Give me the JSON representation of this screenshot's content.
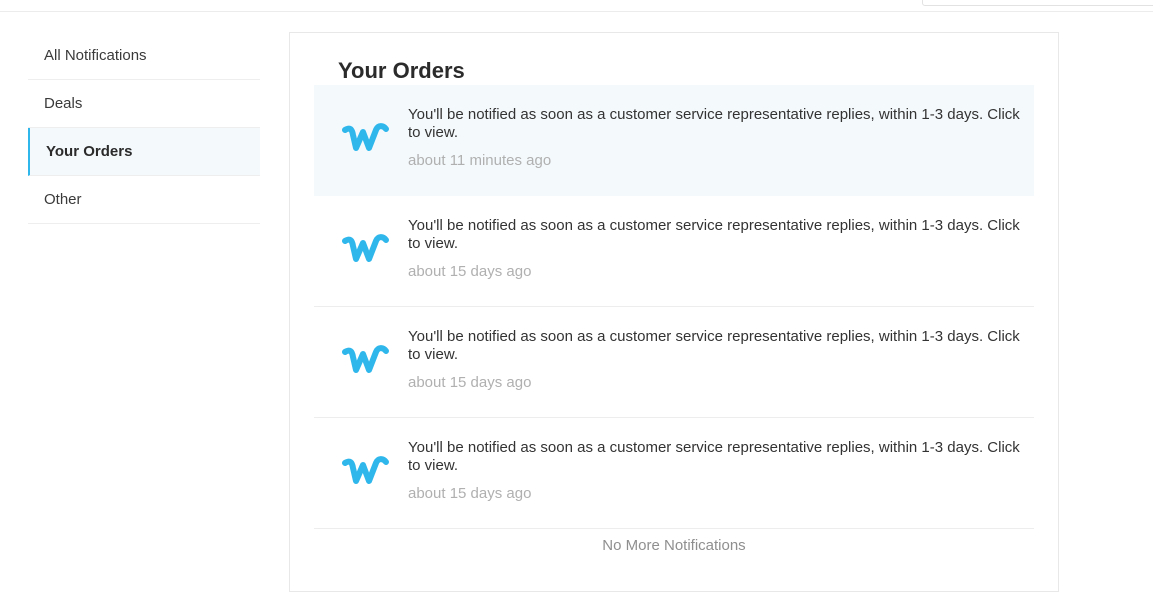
{
  "sidebar": {
    "items": [
      {
        "label": "All Notifications"
      },
      {
        "label": "Deals"
      },
      {
        "label": "Your Orders"
      },
      {
        "label": "Other"
      }
    ],
    "active_index": 2
  },
  "panel": {
    "title": "Your Orders",
    "notifications": [
      {
        "icon": "wish-logo-icon",
        "message": "You'll be notified as soon as a customer service representative replies, within 1-3 days. Click to view.",
        "time": "about 11 minutes ago"
      },
      {
        "icon": "wish-logo-icon",
        "message": "You'll be notified as soon as a customer service representative replies, within 1-3 days. Click to view.",
        "time": "about 15 days ago"
      },
      {
        "icon": "wish-logo-icon",
        "message": "You'll be notified as soon as a customer service representative replies, within 1-3 days. Click to view.",
        "time": "about 15 days ago"
      },
      {
        "icon": "wish-logo-icon",
        "message": "You'll be notified as soon as a customer service representative replies, within 1-3 days. Click to view.",
        "time": "about 15 days ago"
      }
    ],
    "footer": "No More Notifications"
  },
  "colors": {
    "accent": "#2fb7ec",
    "unread_bg": "#f4f9fc",
    "time_text": "#b0b0b0"
  }
}
